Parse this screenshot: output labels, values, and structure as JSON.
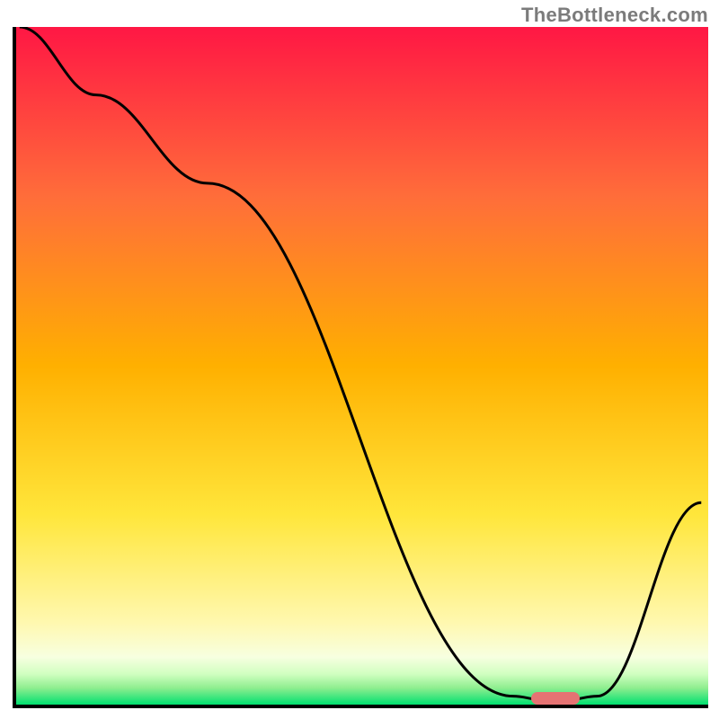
{
  "watermark": "TheBottleneck.com",
  "colors": {
    "axis": "#000000",
    "curve": "#000000",
    "marker": "#e57373",
    "gradient_stops": [
      {
        "offset": 0.0,
        "color": "#ff1744"
      },
      {
        "offset": 0.25,
        "color": "#ff6d3a"
      },
      {
        "offset": 0.5,
        "color": "#ffb000"
      },
      {
        "offset": 0.72,
        "color": "#ffe63b"
      },
      {
        "offset": 0.88,
        "color": "#fff8b0"
      },
      {
        "offset": 0.93,
        "color": "#f7ffe0"
      },
      {
        "offset": 0.955,
        "color": "#d0ffc0"
      },
      {
        "offset": 0.975,
        "color": "#90ee90"
      },
      {
        "offset": 1.0,
        "color": "#00e070"
      }
    ]
  },
  "chart_data": {
    "type": "line",
    "title": "",
    "xlabel": "",
    "ylabel": "",
    "xlim": [
      0,
      100
    ],
    "ylim": [
      0,
      100
    ],
    "x": [
      1,
      12,
      28,
      72,
      76,
      80,
      84,
      99
    ],
    "values": [
      100,
      90,
      77,
      1.5,
      1,
      1,
      1.5,
      30
    ],
    "marker": {
      "x": 78,
      "y": 1.2,
      "width_pct": 7
    },
    "annotations": []
  }
}
